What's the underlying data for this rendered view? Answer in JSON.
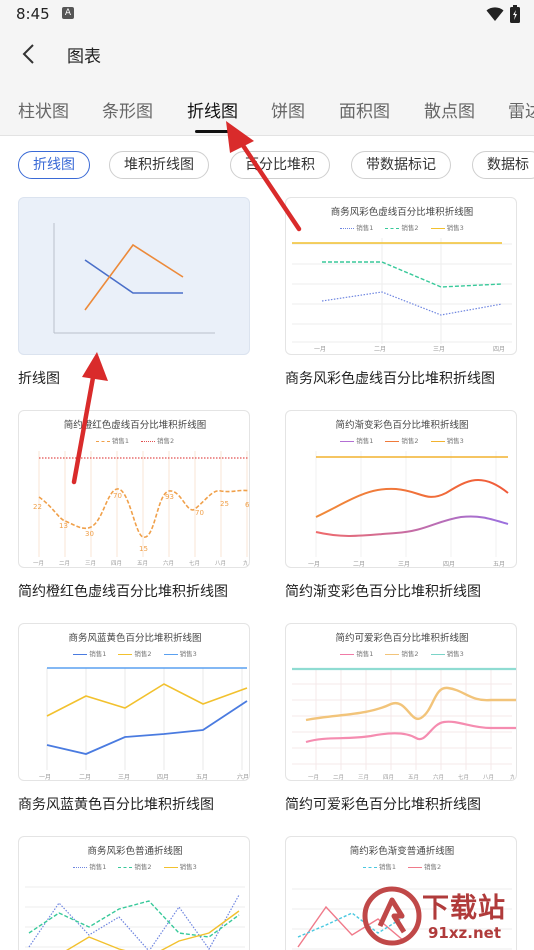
{
  "status": {
    "time": "8:45",
    "notif_letter": "A"
  },
  "appbar": {
    "title": "图表"
  },
  "tabs": [
    "柱状图",
    "条形图",
    "折线图",
    "饼图",
    "面积图",
    "散点图",
    "雷达"
  ],
  "chips": [
    "折线图",
    "堆积折线图",
    "百分比堆积",
    "带数据标记",
    "数据标"
  ],
  "cards": [
    {
      "caption": "折线图"
    },
    {
      "caption": "商务风彩色虚线百分比堆积折线图",
      "mini_title": "商务风彩色虚线百分比堆积折线图",
      "legend": [
        "销售1",
        "销售2",
        "销售3"
      ],
      "xticks": [
        "一月",
        "二月",
        "三月",
        "四月"
      ]
    },
    {
      "caption": "简约橙红色虚线百分比堆积折线图",
      "mini_title": "简约橙红色虚线百分比堆积折线图",
      "legend": [
        "销售1",
        "销售2"
      ],
      "values": [
        "22",
        "13",
        "30",
        "70",
        "15",
        "93",
        "70",
        "25",
        "6"
      ],
      "xticks": [
        "一月",
        "二月",
        "三月",
        "四月",
        "五月",
        "六月",
        "七月",
        "八月",
        "九"
      ]
    },
    {
      "caption": "简约渐变彩色百分比堆积折线图",
      "mini_title": "简约渐变彩色百分比堆积折线图",
      "legend": [
        "销售1",
        "销售2",
        "销售3"
      ],
      "xticks": [
        "一月",
        "二月",
        "三月",
        "四月",
        "五月"
      ]
    },
    {
      "caption": "商务风蓝黄色百分比堆积折线图",
      "mini_title": "商务风蓝黄色百分比堆积折线图",
      "legend": [
        "销售1",
        "销售2",
        "销售3"
      ],
      "xticks": [
        "一月",
        "二月",
        "三月",
        "四月",
        "五月",
        "六月"
      ]
    },
    {
      "caption": "简约可爱彩色百分比堆积折线图",
      "mini_title": "简约可爱彩色百分比堆积折线图",
      "legend": [
        "销售1",
        "销售2",
        "销售3"
      ],
      "xticks": [
        "一月",
        "二月",
        "三月",
        "四月",
        "五月",
        "六月",
        "七月",
        "八月",
        "九"
      ]
    },
    {
      "caption": "",
      "mini_title": "商务风彩色普通折线图",
      "legend": [
        "销售1",
        "销售2",
        "销售3"
      ]
    },
    {
      "caption": "",
      "mini_title": "简约彩色渐变普通折线图",
      "legend": [
        "销售1",
        "销售2"
      ]
    }
  ],
  "watermark": {
    "text": "下载站",
    "url": "91xz.net"
  },
  "colors": {
    "accent": "#3a6ad6",
    "arrow": "#d92b2b",
    "watermark": "#b03b3b"
  }
}
